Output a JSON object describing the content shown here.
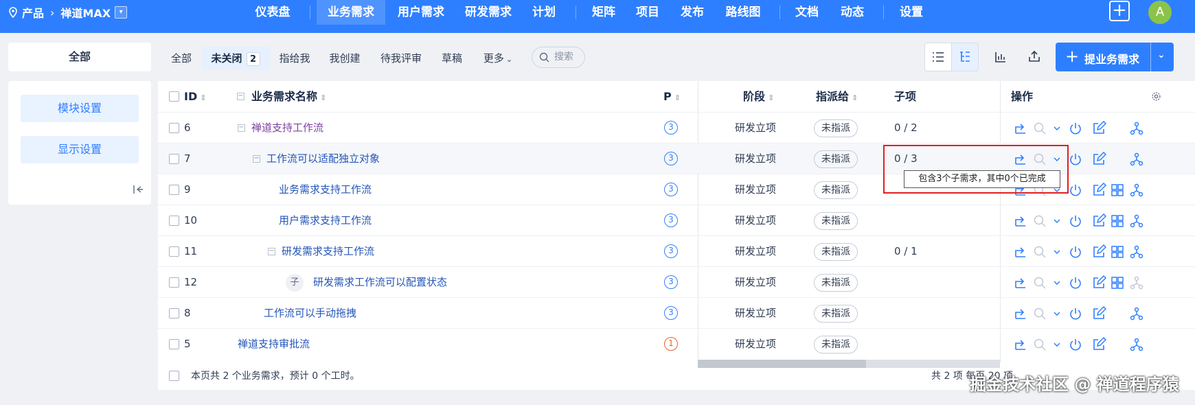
{
  "topbar": {
    "product_label": "产品",
    "product_name": "禅道MAX",
    "nav": [
      "仪表盘",
      "业务需求",
      "用户需求",
      "研发需求",
      "计划",
      "矩阵",
      "项目",
      "发布",
      "路线图",
      "文档",
      "动态",
      "设置"
    ],
    "active_nav": "业务需求",
    "avatar": "A"
  },
  "sidebar": {
    "all_label": "全部",
    "module_settings": "模块设置",
    "display_settings": "显示设置"
  },
  "filters": {
    "tabs": [
      "全部",
      "未关闭",
      "指给我",
      "我创建",
      "待我评审",
      "草稿",
      "更多"
    ],
    "active_tab": "未关闭",
    "unclosed_count": "2",
    "search_placeholder": "搜索"
  },
  "toolbar": {
    "primary_button": "提业务需求"
  },
  "table": {
    "headers": {
      "id": "ID",
      "name": "业务需求名称",
      "priority": "P",
      "stage": "阶段",
      "assigned": "指派给",
      "children": "子项",
      "actions": "操作"
    },
    "rows": [
      {
        "id": "6",
        "name": "禅道支持工作流",
        "priority": "3",
        "stage": "研发立项",
        "assigned": "未指派",
        "children": "0 / 2"
      },
      {
        "id": "7",
        "name": "工作流可以适配独立对象",
        "priority": "3",
        "stage": "研发立项",
        "assigned": "未指派",
        "children": "0 / 3"
      },
      {
        "id": "9",
        "name": "业务需求支持工作流",
        "priority": "3",
        "stage": "研发立项",
        "assigned": "未指派",
        "children": ""
      },
      {
        "id": "10",
        "name": "用户需求支持工作流",
        "priority": "3",
        "stage": "研发立项",
        "assigned": "未指派",
        "children": ""
      },
      {
        "id": "11",
        "name": "研发需求支持工作流",
        "priority": "3",
        "stage": "研发立项",
        "assigned": "未指派",
        "children": "0 / 1"
      },
      {
        "id": "12",
        "name": "研发需求工作流可以配置状态",
        "priority": "3",
        "stage": "研发立项",
        "assigned": "未指派",
        "children": "",
        "tag": "子"
      },
      {
        "id": "8",
        "name": "工作流可以手动拖拽",
        "priority": "3",
        "stage": "研发立项",
        "assigned": "未指派",
        "children": ""
      },
      {
        "id": "5",
        "name": "禅道支持审批流",
        "priority": "1",
        "stage": "研发立项",
        "assigned": "未指派",
        "children": ""
      }
    ],
    "tooltip": "包含3个子需求，其中0个已完成",
    "footer_text": "本页共 2 个业务需求，预计 0 个工时。",
    "pager_text": "共 2 项  每页 20 项"
  },
  "colors": {
    "brand": "#2e7fff",
    "priority_high": "#e3642b",
    "highlight_box": "#e02020"
  },
  "watermark": "掘金技术社区 @ 禅道程序猿"
}
